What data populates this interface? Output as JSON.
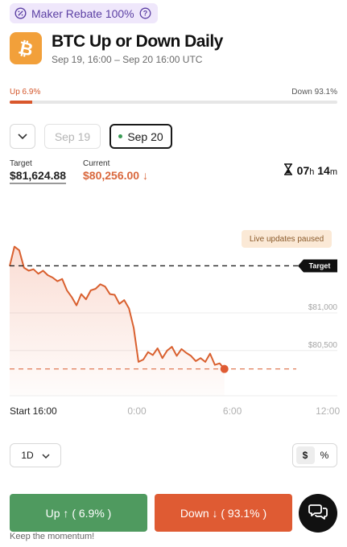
{
  "badge": {
    "label": "Maker Rebate 100%",
    "icon": "rebate-icon",
    "help_icon": "help-circle-icon"
  },
  "market": {
    "logo_icon": "bitcoin-icon",
    "title": "BTC Up or Down Daily",
    "subtitle": "Sep 19, 16:00 – Sep 20 16:00 UTC"
  },
  "probability": {
    "up_label": "Up 6.9%",
    "down_label": "Down 93.1%",
    "up_fraction": 0.069
  },
  "dates": {
    "prev": "Sep 19",
    "current": "Sep 20"
  },
  "prices": {
    "target_label": "Target",
    "target_value": "$81,624.88",
    "current_label": "Current",
    "current_value": "$80,256.00 ↓"
  },
  "timer": {
    "hours": "07",
    "h_unit": "h",
    "minutes": "14",
    "m_unit": "m"
  },
  "status": {
    "paused": "Live updates paused"
  },
  "chart_data": {
    "type": "line",
    "target_label": "Target",
    "target_value": 81624.88,
    "y_tick_labels": [
      "$81,000",
      "$80,500"
    ],
    "y_ticks": [
      81000,
      80500
    ],
    "ylim": [
      79900,
      81950
    ],
    "x_tick_labels": [
      "Start 16:00",
      "0:00",
      "6:00",
      "12:00"
    ],
    "x_hours": [
      0,
      8,
      14,
      20
    ],
    "xlim": [
      0,
      20.6
    ],
    "grid": "horizontal",
    "series": [
      {
        "x": [
          0,
          0.3,
          0.6,
          0.9,
          1.2,
          1.5,
          1.8,
          2.1,
          2.4,
          2.7,
          3.0,
          3.3,
          3.6,
          3.9,
          4.2,
          4.5,
          4.8,
          5.1,
          5.4,
          5.7,
          6.0,
          6.3,
          6.6,
          6.9,
          7.2,
          7.5,
          7.8,
          8.1,
          8.4,
          8.7,
          9.0,
          9.3,
          9.6,
          9.9,
          10.2,
          10.5,
          10.8,
          11.1,
          11.4,
          11.7,
          12.0,
          12.3,
          12.6,
          12.9,
          13.2,
          13.5
        ],
        "y": [
          81620,
          81880,
          81830,
          81600,
          81560,
          81580,
          81520,
          81560,
          81500,
          81470,
          81420,
          81450,
          81300,
          81210,
          81100,
          81250,
          81180,
          81300,
          81320,
          81380,
          81350,
          81250,
          81240,
          81120,
          81170,
          81060,
          80800,
          80350,
          80380,
          80480,
          80440,
          80530,
          80400,
          80500,
          80550,
          80430,
          80520,
          80470,
          80430,
          80360,
          80400,
          80350,
          80460,
          80310,
          80330,
          80256
        ]
      }
    ]
  },
  "controls": {
    "range": "1D",
    "unit_dollar": "$",
    "unit_percent": "%"
  },
  "actions": {
    "up_label": "Up ↑ ( 6.9% )",
    "down_label": "Down ↓ ( 93.1% )",
    "chat_icon": "chat-bubbles-icon"
  },
  "footer": "Keep the momentum!",
  "colors": {
    "up": "#4f9a5f",
    "down": "#df5b33",
    "line": "#d9602f",
    "accent": "#5b3fa3"
  }
}
